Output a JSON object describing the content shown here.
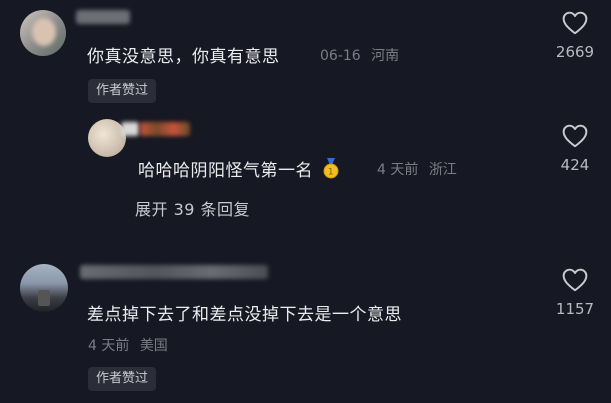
{
  "comments": [
    {
      "text": "你真没意思，你真有意思",
      "date": "06-16",
      "location": "河南",
      "likes": "2669",
      "author_badge": "作者赞过"
    },
    {
      "text": "差点掉下去了和差点没掉下去是一个意思",
      "date": "4 天前",
      "location": "美国",
      "likes": "1157",
      "author_badge": "作者赞过"
    }
  ],
  "reply": {
    "text": "哈哈哈阴阳怪气第一名",
    "medal_icon": "gold-medal-icon",
    "date": "4 天前",
    "location": "浙江",
    "likes": "424"
  },
  "expand_replies_label": "展开 39 条回复",
  "icons": {
    "like": "heart-outline-icon"
  },
  "colors": {
    "background": "#161823",
    "text": "#ececee",
    "meta": "#7b7c85",
    "chip_bg": "#2b2d38"
  }
}
